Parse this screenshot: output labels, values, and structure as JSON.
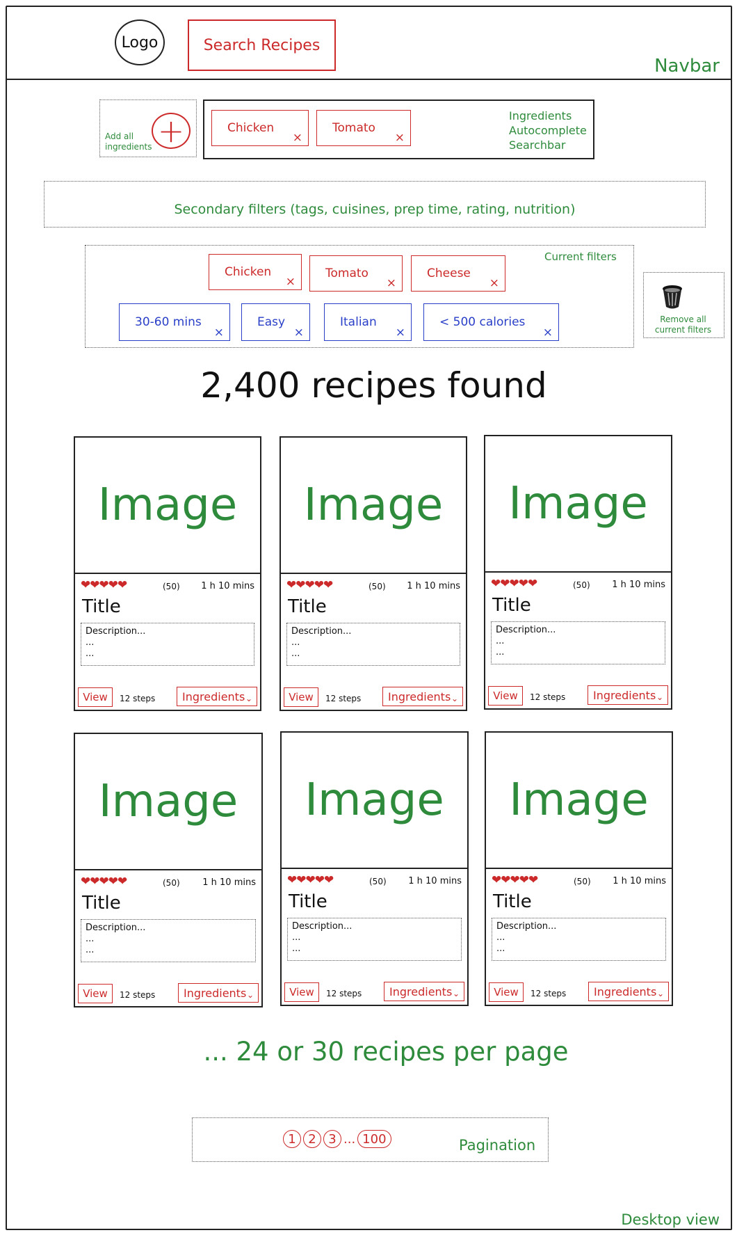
{
  "navbar": {
    "logo": "Logo",
    "search": "Search Recipes",
    "label": "Navbar"
  },
  "ingredients": {
    "add_all_line1": "Add all",
    "add_all_line2": "ingredients",
    "plus_symbol": "+",
    "chips": [
      {
        "label": "Chicken"
      },
      {
        "label": "Tomato"
      }
    ],
    "label_line1": "Ingredients",
    "label_line2": "Autocomplete",
    "label_line3": "Searchbar"
  },
  "secondary_filters": "Secondary filters (tags, cuisines, prep time, rating, nutrition)",
  "current_filters": {
    "label": "Current filters",
    "red_chips": [
      {
        "label": "Chicken"
      },
      {
        "label": "Tomato"
      },
      {
        "label": "Cheese"
      }
    ],
    "blue_chips": [
      {
        "label": "30-60 mins"
      },
      {
        "label": "Easy"
      },
      {
        "label": "Italian"
      },
      {
        "label": "< 500 calories"
      }
    ],
    "remove_line1": "Remove all",
    "remove_line2": "current filters",
    "close_glyph": "×"
  },
  "results_count": "2,400 recipes found",
  "cards": [
    {
      "image": "Image",
      "hearts": "❤❤❤❤❤",
      "rating_count": "(50)",
      "time": "1 h 10 mins",
      "title": "Title",
      "desc1": "Description...",
      "desc2": "...",
      "desc3": "...",
      "view": "View",
      "steps": "12 steps",
      "ingredients": "Ingredients"
    },
    {
      "image": "Image",
      "hearts": "❤❤❤❤❤",
      "rating_count": "(50)",
      "time": "1 h 10 mins",
      "title": "Title",
      "desc1": "Description...",
      "desc2": "...",
      "desc3": "...",
      "view": "View",
      "steps": "12 steps",
      "ingredients": "Ingredients"
    },
    {
      "image": "Image",
      "hearts": "❤❤❤❤❤",
      "rating_count": "(50)",
      "time": "1 h 10 mins",
      "title": "Title",
      "desc1": "Description...",
      "desc2": "...",
      "desc3": "...",
      "view": "View",
      "steps": "12 steps",
      "ingredients": "Ingredients"
    },
    {
      "image": "Image",
      "hearts": "❤❤❤❤❤",
      "rating_count": "(50)",
      "time": "1 h 10 mins",
      "title": "Title",
      "desc1": "Description...",
      "desc2": "...",
      "desc3": "...",
      "view": "View",
      "steps": "12 steps",
      "ingredients": "Ingredients"
    },
    {
      "image": "Image",
      "hearts": "❤❤❤❤❤",
      "rating_count": "(50)",
      "time": "1 h 10 mins",
      "title": "Title",
      "desc1": "Description...",
      "desc2": "...",
      "desc3": "...",
      "view": "View",
      "steps": "12 steps",
      "ingredients": "Ingredients"
    },
    {
      "image": "Image",
      "hearts": "❤❤❤❤❤",
      "rating_count": "(50)",
      "time": "1 h 10 mins",
      "title": "Title",
      "desc1": "Description...",
      "desc2": "...",
      "desc3": "...",
      "view": "View",
      "steps": "12 steps",
      "ingredients": "Ingredients"
    }
  ],
  "chevron_glyph": "⌄",
  "per_page": "... 24 or 30 recipes per page",
  "pagination": {
    "pages": [
      "1",
      "2",
      "3"
    ],
    "ellipsis": "...",
    "last": "100",
    "label": "Pagination"
  },
  "view_label": "Desktop view",
  "colors": {
    "annotation": "#2e8b3c",
    "primary": "#cc2a2a",
    "secondary": "#2a3fc8"
  }
}
